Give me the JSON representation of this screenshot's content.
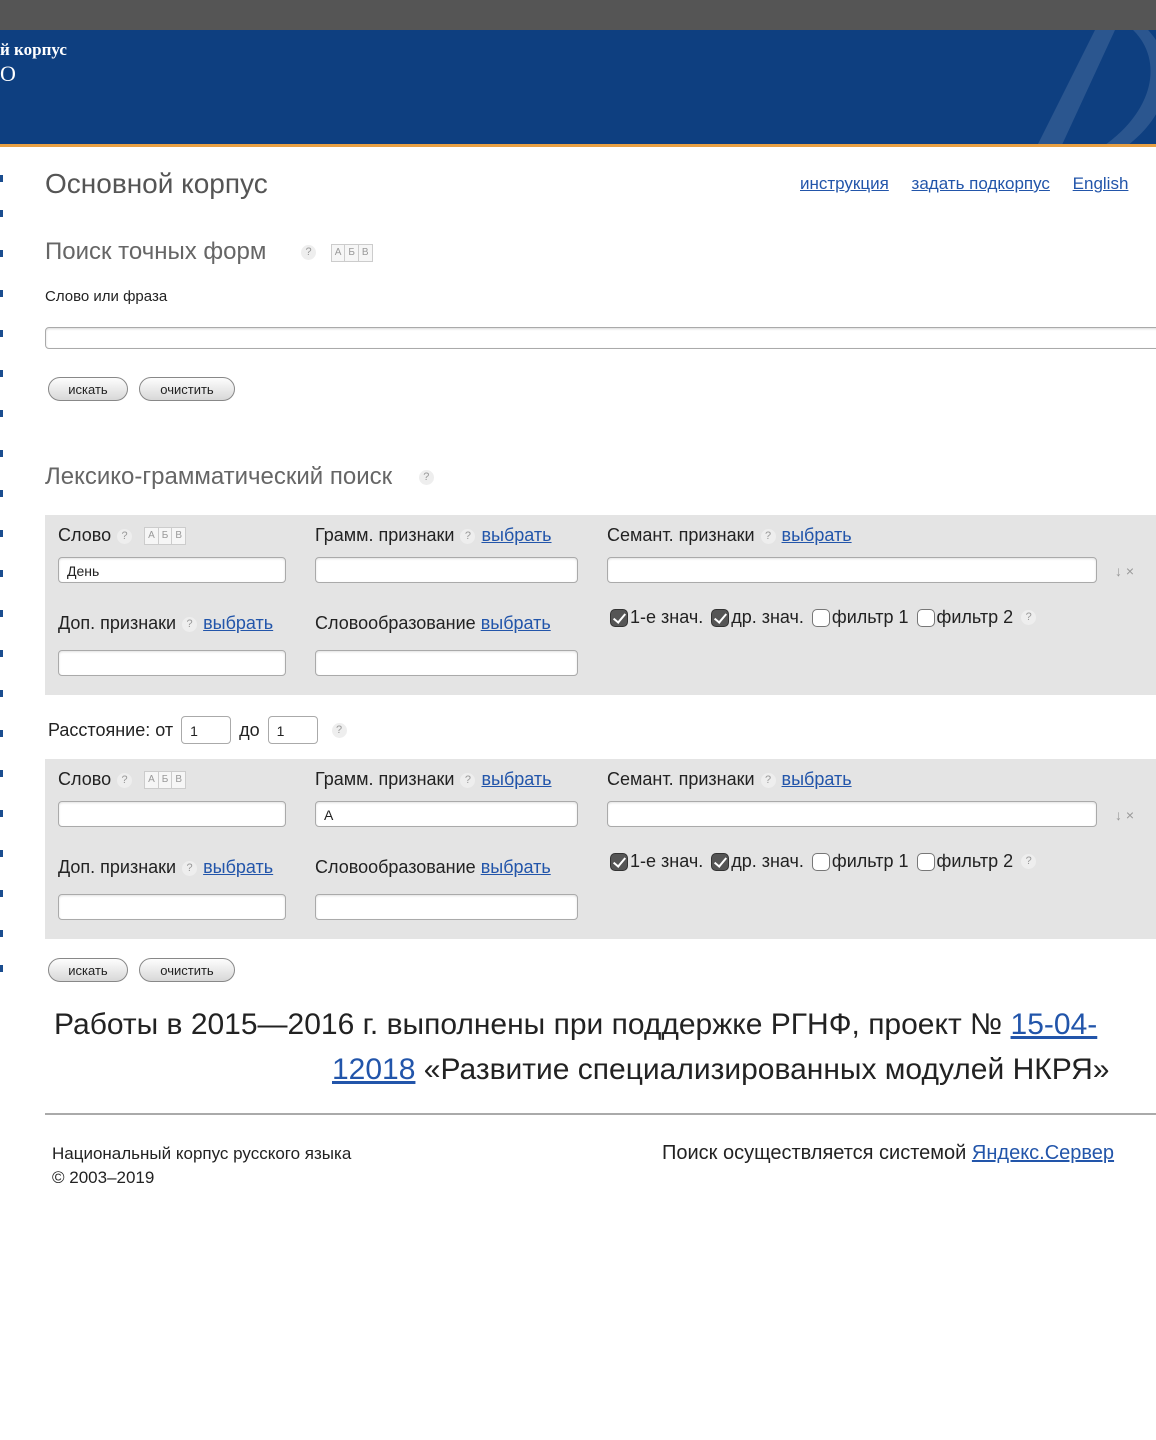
{
  "header": {
    "logo_line1": "й корпус",
    "logo_line2": "О"
  },
  "page_title": "Основной корпус",
  "top_links": {
    "instruction": "инструкция",
    "subcorpus": "задать подкорпус",
    "english": "English"
  },
  "exact_search": {
    "title": "Поиск точных форм",
    "help": "?",
    "keyboard": [
      "А",
      "Б",
      "В"
    ],
    "field_label": "Слово или фраза",
    "field_value": "",
    "search_button": "искать",
    "clear_button": "очистить"
  },
  "lexgram_search": {
    "title": "Лексико-грамматический поиск",
    "help": "?",
    "common": {
      "word_label": "Слово",
      "gram_label": "Грамм. признаки",
      "sem_label": "Семант. признаки",
      "add_label": "Доп. признаки",
      "deriv_label": "Словообразование",
      "choose": "выбрать",
      "help": "?",
      "keyboard": [
        "А",
        "Б",
        "В"
      ],
      "chk1": "1-е знач.",
      "chk2": "др. знач.",
      "chk3": "фильтр 1",
      "chk4": "фильтр 2",
      "row_icons": "↓ ×"
    },
    "rows": [
      {
        "word": "День",
        "gram": "",
        "sem": "",
        "add": "",
        "deriv": "",
        "checks": [
          true,
          true,
          false,
          false
        ]
      },
      {
        "word": "",
        "gram": "A",
        "sem": "",
        "add": "",
        "deriv": "",
        "checks": [
          true,
          true,
          false,
          false
        ]
      }
    ],
    "distance": {
      "label": "Расстояние: от",
      "from": "1",
      "to_label": "до",
      "to": "1",
      "help": "?"
    },
    "search_button": "искать",
    "clear_button": "очистить"
  },
  "support": {
    "line1_text": "Работы в 2015—2016 г. выполнены при поддержке РГНФ, проект № ",
    "line1_link": "15-04-",
    "line2_link": "12018",
    "line2_text": " «Развитие специализированных модулей НКРЯ»"
  },
  "footer": {
    "name": "Национальный корпус русского языка",
    "copyright": "© 2003–2019",
    "search_by": "Поиск осуществляется системой ",
    "search_link": "Яндекс.Сервер"
  },
  "colors": {
    "header_bg": "#0e3f80",
    "header_border": "#e8a043",
    "link": "#2255aa",
    "panel_bg": "#e4e4e4"
  }
}
